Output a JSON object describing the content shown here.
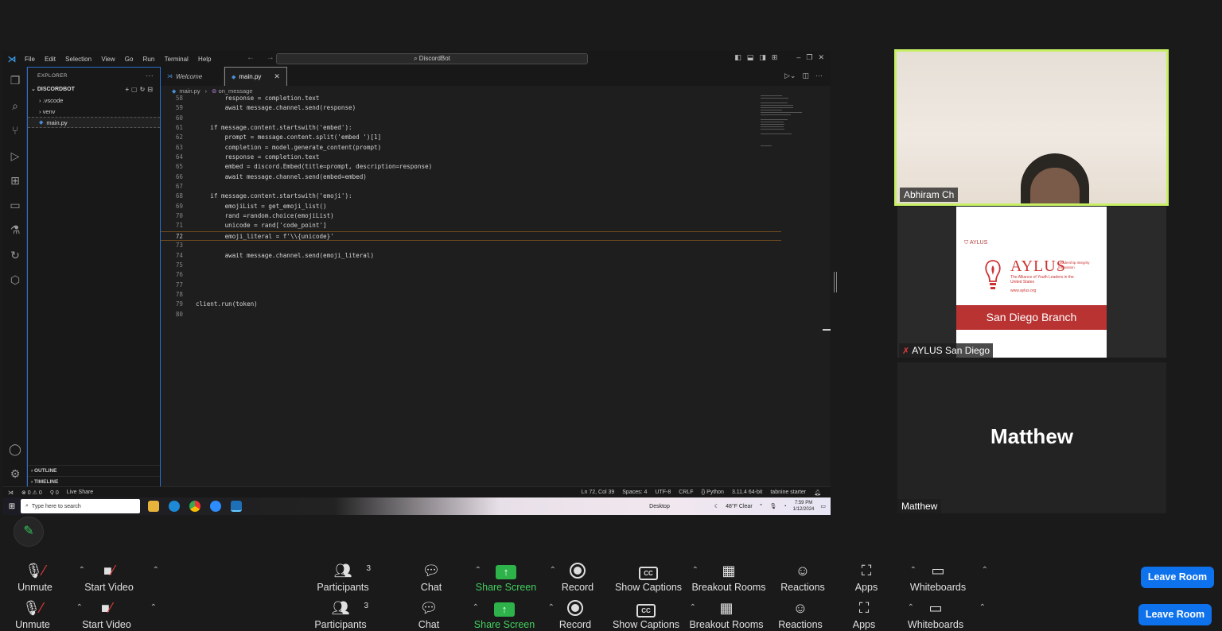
{
  "vscode": {
    "menu": [
      "File",
      "Edit",
      "Selection",
      "View",
      "Go",
      "Run",
      "Terminal",
      "Help"
    ],
    "search_text": "DiscordBot",
    "explorer_title": "EXPLORER",
    "project": "DISCORDBOT",
    "tree": [
      ".vscode",
      "venv",
      "main.py"
    ],
    "outline": "OUTLINE",
    "timeline": "TIMELINE",
    "tabs": [
      "Welcome",
      "main.py"
    ],
    "breadcrumb_file": "main.py",
    "breadcrumb_symbol": "on_message",
    "code_lines": [
      {
        "n": "58",
        "t": "        response = completion.text"
      },
      {
        "n": "59",
        "t": "        await message.channel.send(response)"
      },
      {
        "n": "60",
        "t": ""
      },
      {
        "n": "61",
        "t": "    if message.content.startswith('embed'):"
      },
      {
        "n": "62",
        "t": "        prompt = message.content.split('embed ')[1]"
      },
      {
        "n": "63",
        "t": "        completion = model.generate_content(prompt)"
      },
      {
        "n": "64",
        "t": "        response = completion.text"
      },
      {
        "n": "65",
        "t": "        embed = discord.Embed(title=prompt, description=response)"
      },
      {
        "n": "66",
        "t": "        await message.channel.send(embed=embed)"
      },
      {
        "n": "67",
        "t": ""
      },
      {
        "n": "68",
        "t": "    if message.content.startswith('emoji'):"
      },
      {
        "n": "69",
        "t": "        emojiList = get_emoji_list()"
      },
      {
        "n": "70",
        "t": "        rand =random.choice(emojiList)"
      },
      {
        "n": "71",
        "t": "        unicode = rand['code_point']"
      },
      {
        "n": "72",
        "t": "        emoji_literal = f'\\\\{unicode}'"
      },
      {
        "n": "73",
        "t": ""
      },
      {
        "n": "74",
        "t": "        await message.channel.send(emoji_literal)"
      },
      {
        "n": "75",
        "t": ""
      },
      {
        "n": "76",
        "t": ""
      },
      {
        "n": "77",
        "t": ""
      },
      {
        "n": "78",
        "t": ""
      },
      {
        "n": "79",
        "t": "client.run(token)"
      },
      {
        "n": "80",
        "t": ""
      }
    ],
    "current_line": "72",
    "status_left": [
      "⊗ 0 ⚠ 0",
      "⚲ 0",
      "Live Share"
    ],
    "status_right": [
      "Ln 72, Col 39",
      "Spaces: 4",
      "UTF-8",
      "CRLF",
      "{} Python",
      "3.11.4 64-bit",
      "tabnine starter"
    ],
    "accent": "#3b9be8"
  },
  "taskbar": {
    "search_placeholder": "Type here to search",
    "desktop": "Desktop",
    "weather": "48°F  Clear",
    "time": "7:59 PM",
    "date": "1/12/2024"
  },
  "participants": {
    "abhiram": {
      "name": "Abhiram Ch",
      "highlight": "#c6ef64"
    },
    "aylus": {
      "name": "AYLUS San Diego",
      "card_small": "AYLUS",
      "card_big": "AYLUS",
      "card_tagline": "Leadership Integrity Innovation",
      "card_sub": "The Alliance of Youth Leaders in the United States",
      "card_url": "www.aylus.org",
      "card_band": "San Diego Branch"
    },
    "matthew": {
      "name": "Matthew",
      "big_name": "Matthew"
    }
  },
  "toolbar": {
    "unmute": "Unmute",
    "start_video": "Start Video",
    "participants": "Participants",
    "participant_count": "3",
    "chat": "Chat",
    "share_screen": "Share Screen",
    "record": "Record",
    "show_captions": "Show Captions",
    "breakout_rooms": "Breakout Rooms",
    "reactions": "Reactions",
    "apps": "Apps",
    "whiteboards": "Whiteboards",
    "leave": "Leave Room",
    "share_color": "#2db34a",
    "leave_color": "#0e72ed"
  }
}
